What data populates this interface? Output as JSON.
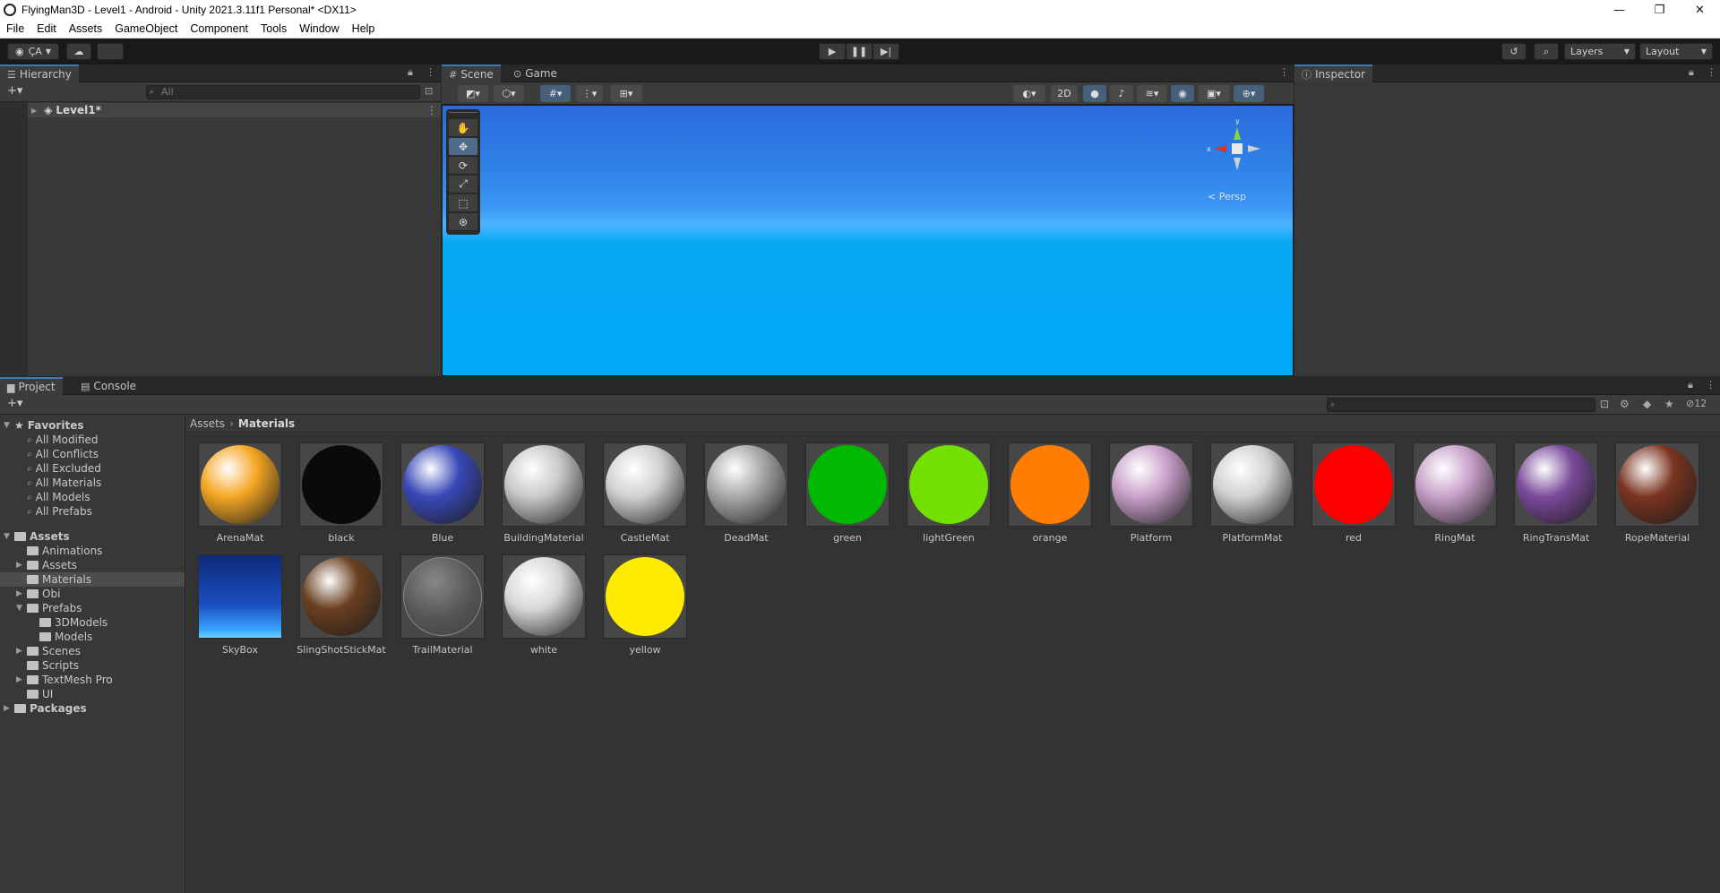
{
  "window": {
    "title": "FlyingMan3D - Level1 - Android - Unity 2021.3.11f1 Personal* <DX11>",
    "minimize": "—",
    "maximize": "❐",
    "close": "✕"
  },
  "menu": [
    "File",
    "Edit",
    "Assets",
    "GameObject",
    "Component",
    "Tools",
    "Window",
    "Help"
  ],
  "toolbar": {
    "account_label": "ÇA",
    "layers_label": "Layers",
    "layout_label": "Layout"
  },
  "hierarchy": {
    "tab": "Hierarchy",
    "search_placeholder": "All",
    "root_item": "Level1*"
  },
  "scene": {
    "tab_scene": "Scene",
    "tab_game": "Game",
    "btn_2d": "2D",
    "persp_label": "Persp",
    "gizmo_x": "x",
    "gizmo_y": "y"
  },
  "inspector": {
    "tab": "Inspector"
  },
  "project": {
    "tab_project": "Project",
    "tab_console": "Console",
    "hidden_count": "12",
    "breadcrumb": [
      "Assets",
      "Materials"
    ],
    "tree": {
      "favorites": "Favorites",
      "favorites_items": [
        "All Modified",
        "All Conflicts",
        "All Excluded",
        "All Materials",
        "All Models",
        "All Prefabs"
      ],
      "assets": "Assets",
      "assets_children": [
        "Animations",
        "Assets",
        "Materials",
        "Obi",
        "Prefabs",
        "3DModels",
        "Models",
        "Scenes",
        "Scripts",
        "TextMesh Pro",
        "UI"
      ],
      "packages": "Packages"
    },
    "assets": [
      {
        "name": "ArenaMat",
        "color": "#f5a623"
      },
      {
        "name": "black",
        "color": "#0a0a0a"
      },
      {
        "name": "Blue",
        "color": "#3949b8"
      },
      {
        "name": "BuildingMaterial",
        "color": "#c8c8c8"
      },
      {
        "name": "CastleMat",
        "color": "#d0d0d0"
      },
      {
        "name": "DeadMat",
        "color": "#a8a8a8"
      },
      {
        "name": "green",
        "color": "#00b800"
      },
      {
        "name": "lightGreen",
        "color": "#72e000"
      },
      {
        "name": "orange",
        "color": "#ff7d00"
      },
      {
        "name": "Platform",
        "color": "#c9a0c9"
      },
      {
        "name": "PlatformMat",
        "color": "#d0d0d0"
      },
      {
        "name": "red",
        "color": "#ff0000"
      },
      {
        "name": "RingMat",
        "color": "#c8a0c8"
      },
      {
        "name": "RingTransMat",
        "color": "#7a4a9a"
      },
      {
        "name": "RopeMaterial",
        "color": "#7a3420"
      },
      {
        "name": "SkyBox",
        "color": "#1b4fc0"
      },
      {
        "name": "SlingShotStickMat",
        "color": "#6a4020"
      },
      {
        "name": "TrailMaterial",
        "color": "#6a6a6a"
      },
      {
        "name": "white",
        "color": "#d8d8d8"
      },
      {
        "name": "yellow",
        "color": "#ffeb00"
      }
    ]
  }
}
